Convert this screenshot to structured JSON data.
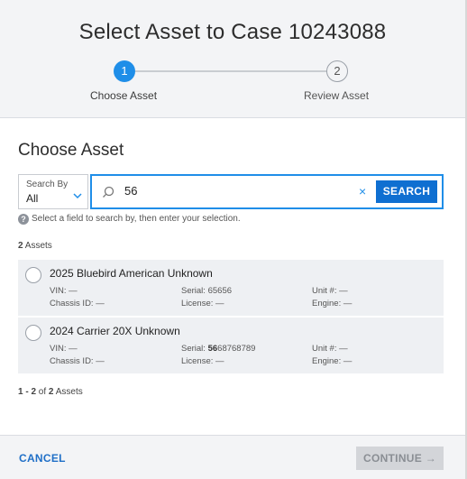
{
  "header": {
    "title": "Select Asset to Case 10243088",
    "steps": [
      {
        "number": "1",
        "label": "Choose Asset",
        "active": true
      },
      {
        "number": "2",
        "label": "Review Asset",
        "active": false
      }
    ]
  },
  "section": {
    "title": "Choose Asset"
  },
  "search": {
    "by_label": "Search By",
    "by_value": "All",
    "query": "56",
    "clear_glyph": "×",
    "button_label": "SEARCH",
    "hint": "Select a field to search by, then enter your selection.",
    "hint_icon": "?"
  },
  "results": {
    "count_number": "2",
    "count_text": " Assets",
    "assets": [
      {
        "name": "2025 Bluebird American Unknown",
        "vin": "VIN: —",
        "chassis": "Chassis ID: —",
        "serial_prefix": "Serial: 6",
        "serial_match": "56",
        "serial_suffix": "56",
        "license": "License: —",
        "unit": "Unit #: —",
        "engine": "Engine: —"
      },
      {
        "name": "2024 Carrier 20X Unknown",
        "vin": "VIN: —",
        "chassis": "Chassis ID: —",
        "serial_prefix": "Serial: ",
        "serial_match": "56",
        "serial_suffix": "68768789",
        "license": "License: —",
        "unit": "Unit #: —",
        "engine": "Engine: —"
      }
    ],
    "pager": {
      "range": "1 - 2",
      "of": " of ",
      "total": "2",
      "suffix": " Assets"
    }
  },
  "footer": {
    "cancel_label": "CANCEL",
    "continue_label": "CONTINUE",
    "continue_arrow": "→"
  },
  "colors": {
    "accent": "#1f8ee8",
    "button": "#0f6fd1",
    "disabled": "#d3d5d9"
  }
}
